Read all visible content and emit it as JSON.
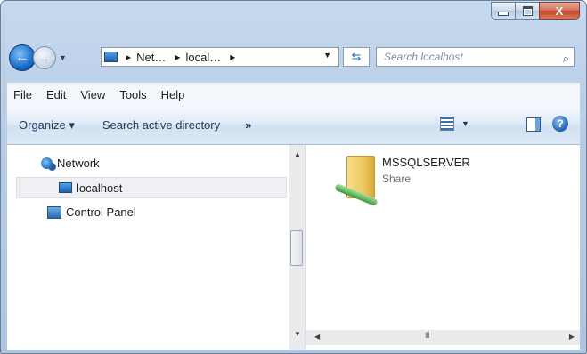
{
  "window": {
    "caption_buttons": {
      "minimize": "minimize",
      "maximize": "maximize",
      "close": "X"
    }
  },
  "nav": {
    "back_icon": "arrow-left",
    "forward_icon": "arrow-right",
    "breadcrumbs": [
      "Net…",
      "local…"
    ],
    "search_placeholder": "Search localhost"
  },
  "menu": [
    "File",
    "Edit",
    "View",
    "Tools",
    "Help"
  ],
  "toolbar": {
    "organize": "Organize ▾",
    "search_ad": "Search active directory",
    "more": "»"
  },
  "tree": [
    {
      "label": "Network",
      "icon": "network-icon"
    },
    {
      "label": "localhost",
      "icon": "computer-icon",
      "selected": true
    },
    {
      "label": "Control Panel",
      "icon": "control-panel-icon"
    }
  ],
  "items": [
    {
      "name": "MSSQLSERVER",
      "type": "Share"
    }
  ],
  "scroll": {
    "grip": "III"
  }
}
